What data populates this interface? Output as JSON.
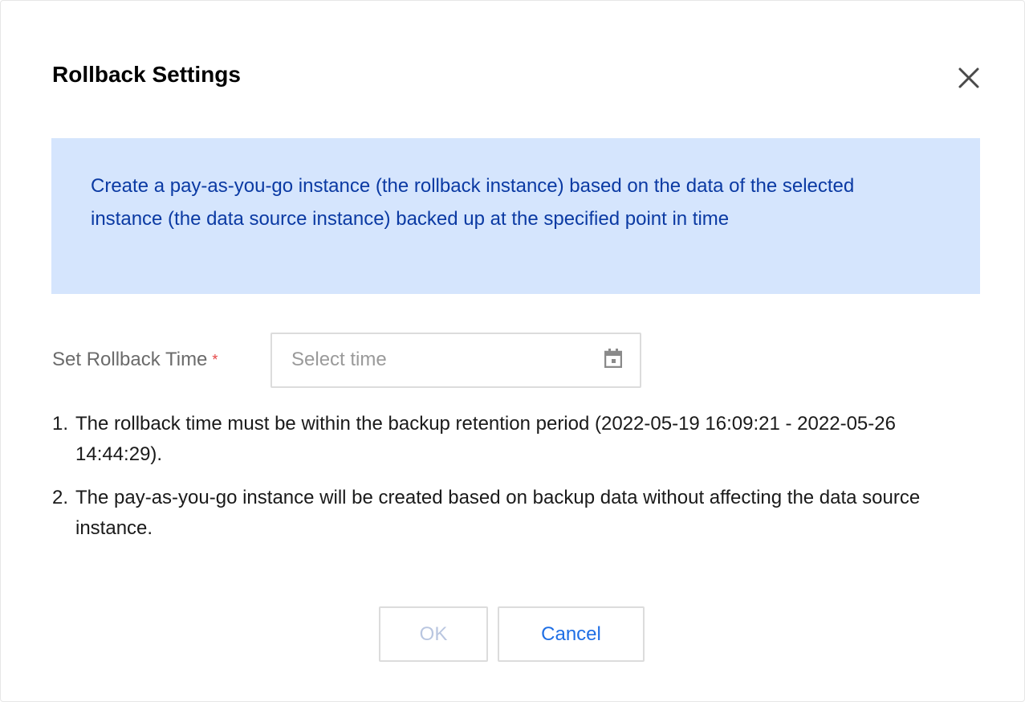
{
  "dialog": {
    "title": "Rollback Settings",
    "close_icon": "close-icon"
  },
  "info": {
    "text": "Create a pay-as-you-go instance (the rollback instance) based on the data of the selected instance (the data source instance) backed up at the specified point in time"
  },
  "form": {
    "label": "Set Rollback Time",
    "required_mark": "*",
    "placeholder": "Select time",
    "value": "",
    "icon": "calendar-icon"
  },
  "notes": [
    {
      "num": "1.",
      "text": "The rollback time must be within the backup retention period (2022-05-19 16:09:21 - 2022-05-26 14:44:29)."
    },
    {
      "num": "2.",
      "text": "The pay-as-you-go instance will be created based on backup data without affecting the data source instance."
    }
  ],
  "buttons": {
    "ok_label": "OK",
    "cancel_label": "Cancel"
  },
  "colors": {
    "info_bg": "#d5e5fd",
    "info_text": "#0b3aa3",
    "link": "#1f6fe5",
    "required": "#e54545",
    "disabled_text": "#b9c6e0"
  }
}
